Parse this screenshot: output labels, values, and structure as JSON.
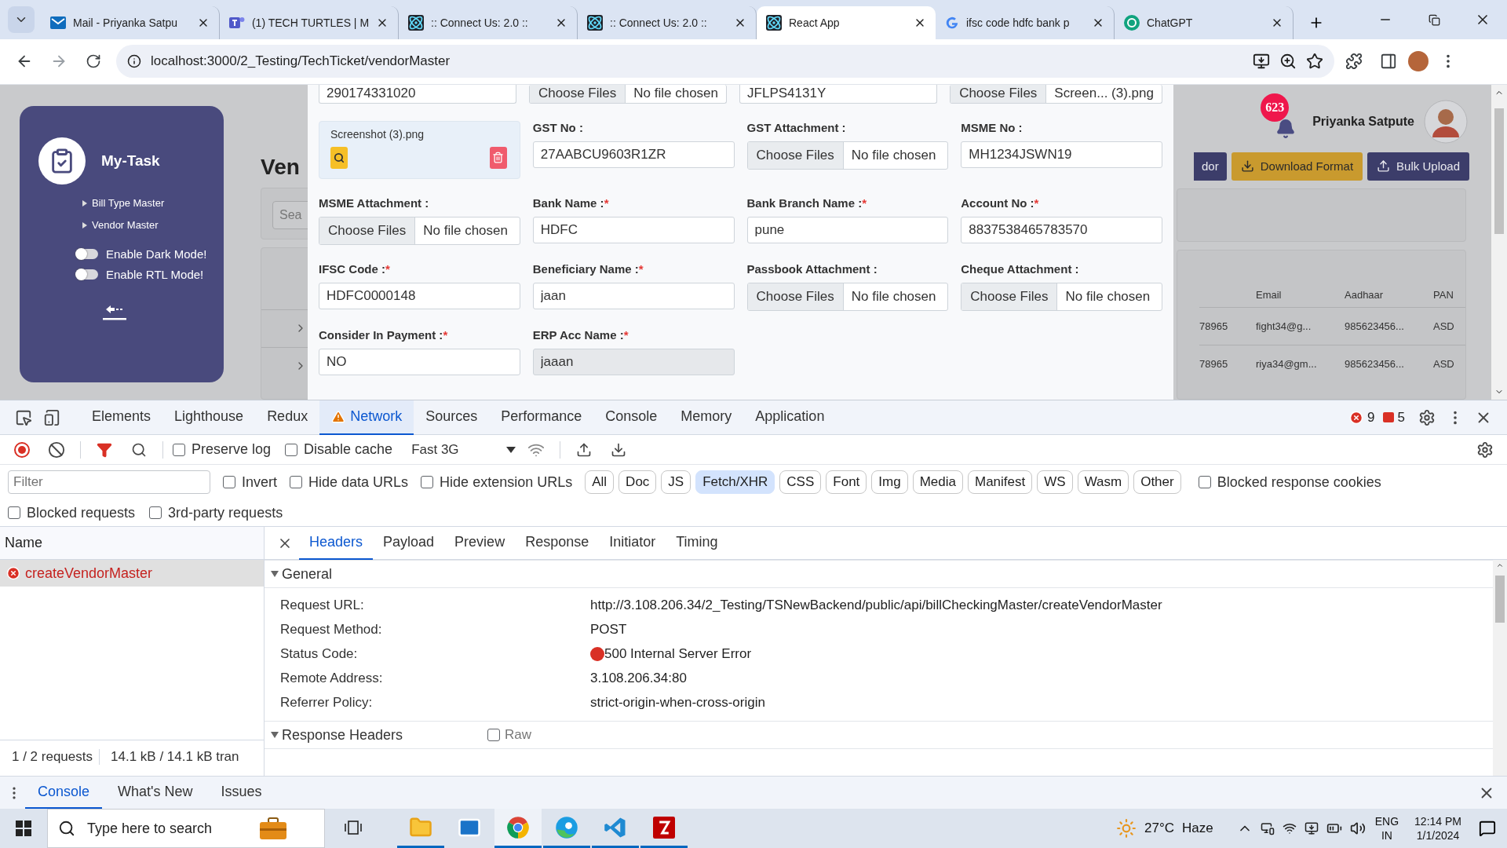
{
  "browser": {
    "tabs": [
      {
        "kind": "mail",
        "title": "Mail - Priyanka Satpu",
        "selected": false
      },
      {
        "kind": "teams",
        "title": "(1) TECH TURTLES | M",
        "selected": false
      },
      {
        "kind": "react",
        "title": ":: Connect Us: 2.0 ::",
        "selected": false
      },
      {
        "kind": "react",
        "title": ":: Connect Us: 2.0 ::",
        "selected": false
      },
      {
        "kind": "react",
        "title": "React App",
        "selected": true
      },
      {
        "kind": "search",
        "title": "ifsc code hdfc bank p",
        "selected": false
      },
      {
        "kind": "chat",
        "title": "ChatGPT",
        "selected": false
      }
    ],
    "url": "localhost:3000/2_Testing/TechTicket/vendorMaster"
  },
  "page": {
    "sidebar": {
      "brand": "My-Task",
      "items": [
        "Bill Type Master",
        "Vendor Master"
      ],
      "toggles": [
        {
          "label": "Enable Dark Mode!",
          "on": false
        },
        {
          "label": "Enable RTL Mode!",
          "on": false
        }
      ]
    },
    "heading": "Ven",
    "search": {
      "placeholder": "Sea"
    },
    "notification_count": "623",
    "user_name": "Priyanka Satpute",
    "actions": [
      {
        "kind": "plain",
        "label": "dor"
      },
      {
        "kind": "download",
        "label": "Download Format"
      },
      {
        "kind": "upload",
        "label": "Bulk Upload"
      }
    ],
    "table": {
      "columns": [
        "",
        "Email",
        "Aadhaar",
        "PAN"
      ],
      "rows": [
        {
          "cells": [
            "78965",
            "fight34@g...",
            "985623456...",
            "ASD"
          ]
        },
        {
          "cells": [
            "78965",
            "riya34@gm...",
            "985623456...",
            "ASD"
          ]
        }
      ]
    },
    "modal": {
      "rows": [
        [
          {
            "kind": "text",
            "value": "290174331020",
            "disabled": false
          },
          {
            "kind": "file",
            "button": "Choose Files",
            "file": "No file chosen"
          },
          {
            "kind": "text",
            "value": "JFLPS4131Y",
            "disabled": false
          },
          {
            "kind": "file",
            "button": "Choose Files",
            "file": "Screen... (3).png"
          }
        ],
        [
          {
            "kind": "preview",
            "file": "Screenshot (3).png"
          },
          {
            "kind": "text",
            "label": "GST No :",
            "value": "27AABCU9603R1ZR",
            "disabled": false
          },
          {
            "kind": "file",
            "label": "GST Attachment :",
            "button": "Choose Files",
            "file": "No file chosen"
          },
          {
            "kind": "text",
            "label": "MSME No :",
            "value": "MH1234JSWN19",
            "disabled": false
          }
        ],
        [
          {
            "kind": "file",
            "label": "MSME Attachment :",
            "button": "Choose Files",
            "file": "No file chosen"
          },
          {
            "kind": "text",
            "label": "Bank Name :",
            "mark": "*",
            "value": "HDFC",
            "disabled": false
          },
          {
            "kind": "text",
            "label": "Bank Branch Name :",
            "mark": "*",
            "value": "pune",
            "disabled": false
          },
          {
            "kind": "text",
            "label": "Account No :",
            "mark": "*",
            "value": "8837538465783570",
            "disabled": false
          }
        ],
        [
          {
            "kind": "text",
            "label": "IFSC Code :",
            "mark": "*",
            "value": "HDFC0000148",
            "disabled": false
          },
          {
            "kind": "text",
            "label": "Beneficiary Name :",
            "mark": "*",
            "value": "jaan",
            "disabled": false
          },
          {
            "kind": "file",
            "label": "Passbook Attachment :",
            "button": "Choose Files",
            "file": "No file chosen"
          },
          {
            "kind": "file",
            "label": "Cheque Attachment :",
            "button": "Choose Files",
            "file": "No file chosen"
          }
        ],
        [
          {
            "kind": "text",
            "label": "Consider In Payment :",
            "mark": "*",
            "value": "NO",
            "disabled": false
          },
          {
            "kind": "text",
            "label": "ERP Acc Name :",
            "mark": "*",
            "value": "jaaan",
            "disabled": true
          }
        ]
      ]
    }
  },
  "devtools": {
    "tabs": [
      {
        "label": "Elements",
        "selected": false,
        "warning": false
      },
      {
        "label": "Lighthouse",
        "selected": false,
        "warning": false
      },
      {
        "label": "Redux",
        "selected": false,
        "warning": false
      },
      {
        "label": "Network",
        "selected": true,
        "warning": true
      },
      {
        "label": "Sources",
        "selected": false,
        "warning": false
      },
      {
        "label": "Performance",
        "selected": false,
        "warning": false
      },
      {
        "label": "Console",
        "selected": false,
        "warning": false
      },
      {
        "label": "Memory",
        "selected": false,
        "warning": false
      },
      {
        "label": "Application",
        "selected": false,
        "warning": false
      }
    ],
    "error_count": "9",
    "issue_count": "5",
    "toolbar": {
      "checkboxes": [
        {
          "label": "Preserve log",
          "checked": false
        },
        {
          "label": "Disable cache",
          "checked": false
        }
      ],
      "throttle": "Fast 3G"
    },
    "filter": {
      "placeholder": "Filter",
      "checkboxes": [
        {
          "label": "Invert",
          "checked": false
        },
        {
          "label": "Hide data URLs",
          "checked": false
        },
        {
          "label": "Hide extension URLs",
          "checked": false
        }
      ],
      "types": [
        {
          "label": "All",
          "selected": false
        },
        {
          "label": "Doc",
          "selected": false
        },
        {
          "label": "JS",
          "selected": false
        },
        {
          "label": "Fetch/XHR",
          "selected": true
        },
        {
          "label": "CSS",
          "selected": false
        },
        {
          "label": "Font",
          "selected": false
        },
        {
          "label": "Img",
          "selected": false
        },
        {
          "label": "Media",
          "selected": false
        },
        {
          "label": "Manifest",
          "selected": false
        },
        {
          "label": "WS",
          "selected": false
        },
        {
          "label": "Wasm",
          "selected": false
        },
        {
          "label": "Other",
          "selected": false
        }
      ],
      "more_checkboxes": [
        {
          "label": "Blocked response cookies",
          "checked": false
        },
        {
          "label": "Blocked requests",
          "checked": false
        },
        {
          "label": "3rd-party requests",
          "checked": false
        }
      ]
    },
    "requests": {
      "heading": "Name",
      "items": [
        {
          "name": "createVendorMaster",
          "selected": true,
          "failed": true
        }
      ],
      "summary": [
        "1 / 2 requests",
        "14.1 kB / 14.1 kB tran"
      ]
    },
    "detail": {
      "tabs": [
        {
          "label": "Headers",
          "selected": true
        },
        {
          "label": "Payload",
          "selected": false
        },
        {
          "label": "Preview",
          "selected": false
        },
        {
          "label": "Response",
          "selected": false
        },
        {
          "label": "Initiator",
          "selected": false
        },
        {
          "label": "Timing",
          "selected": false
        }
      ],
      "sections": [
        {
          "title": "General",
          "expanded": true,
          "rows": [
            {
              "label": "Request URL:",
              "value": "http://3.108.206.34/2_Testing/TSNewBackend/public/api/billCheckingMaster/createVendorMaster"
            },
            {
              "label": "Request Method:",
              "value": "POST"
            },
            {
              "label": "Status Code:",
              "value": "500 Internal Server Error",
              "color": "#d93025"
            },
            {
              "label": "Remote Address:",
              "value": "3.108.206.34:80"
            },
            {
              "label": "Referrer Policy:",
              "value": "strict-origin-when-cross-origin"
            }
          ]
        },
        {
          "title": "Response Headers",
          "expanded": true,
          "raw": {
            "label": "Raw",
            "checked": false
          }
        }
      ]
    },
    "drawer": {
      "tabs": [
        {
          "label": "Console",
          "selected": true
        },
        {
          "label": "What's New",
          "selected": false
        },
        {
          "label": "Issues",
          "selected": false
        }
      ]
    }
  },
  "taskbar": {
    "search": {
      "placeholder": "Type here to search"
    },
    "apps": [
      {
        "kind": "explorer",
        "running": true,
        "active": false
      },
      {
        "kind": "mail",
        "running": false,
        "active": false
      },
      {
        "kind": "chrome",
        "running": true,
        "active": true
      },
      {
        "kind": "edge",
        "running": true,
        "active": false
      },
      {
        "kind": "vscode",
        "running": true,
        "active": false
      },
      {
        "kind": "filezilla",
        "running": true,
        "active": false
      }
    ],
    "weather": {
      "temp": "27°C",
      "condition": "Haze"
    },
    "language": [
      "ENG",
      "IN"
    ],
    "time": "12:14 PM",
    "date": "1/1/2024"
  }
}
